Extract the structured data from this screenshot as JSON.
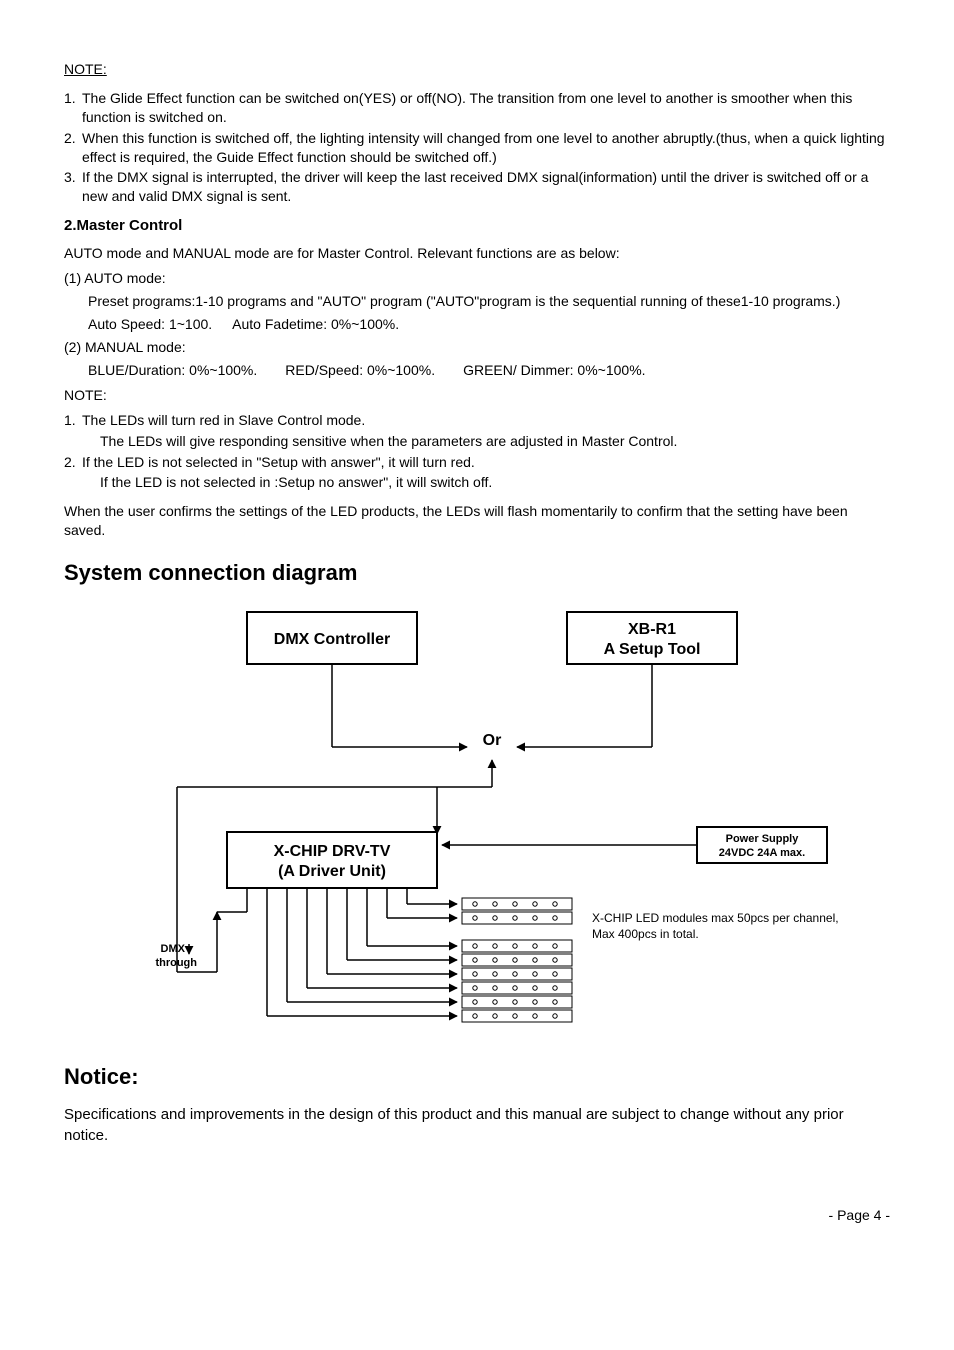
{
  "note_heading": "NOTE:",
  "note_items": [
    {
      "num": "1.",
      "text": "The Glide Effect function can be switched on(YES) or off(NO). The transition from one level to another is smoother when this function is switched on."
    },
    {
      "num": "2.",
      "text": "When this function is switched off, the lighting intensity will changed from one level to another abruptly.(thus, when a quick lighting effect is required, the Guide Effect function should be switched off.)"
    },
    {
      "num": "3.",
      "text": "If the DMX signal is interrupted, the driver will keep the last received DMX signal(information) until the driver is switched off or a new and valid DMX signal is sent."
    }
  ],
  "master": {
    "heading": "2.Master Control",
    "intro": "AUTO mode and MANUAL mode are for Master Control. Relevant functions are as below:",
    "auto_label": "(1) AUTO   mode:",
    "auto_presets": "Preset programs:1-10 programs and \"AUTO\" program (\"AUTO\"program is the sequential running of these1-10 programs.)",
    "auto_speed": "Auto Speed: 1~100.",
    "auto_fade": "Auto Fadetime: 0%~100%.",
    "manual_label": "(2) MANUAL mode:",
    "blue": "BLUE/Duration: 0%~100%.",
    "red": "RED/Speed: 0%~100%.",
    "green": "GREEN/ Dimmer: 0%~100%."
  },
  "note2_heading": "NOTE:",
  "note2_items": [
    {
      "num": "1.",
      "text": "The LEDs will turn red in Slave Control mode."
    },
    {
      "num": "",
      "text": "The LEDs will give responding sensitive when the parameters are adjusted in Master Control."
    },
    {
      "num": "2.",
      "text": "If the LED is not selected in \"Setup with answer\", it will turn red."
    },
    {
      "num": "",
      "text": "If the LED is not selected in :Setup no answer\", it will switch off."
    }
  ],
  "note2_tail": "When the user confirms the settings of the LED products, the LEDs will flash momentarily to confirm that the setting have been saved.",
  "diagram_heading": "System connection diagram",
  "diagram": {
    "dmx_controller": "DMX Controller",
    "xb_r1_line1": "XB-R1",
    "xb_r1_line2": "A Setup Tool",
    "or": "Or",
    "driver_line1": "X-CHIP DRV-TV",
    "driver_line2": "(A Driver Unit)",
    "dmx_through_line1": "DMX",
    "dmx_through_line2": "through",
    "psu_line1": "Power Supply",
    "psu_line2": "24VDC 24A max.",
    "modules_line1": "X-CHIP LED modules max 50pcs per channel,",
    "modules_line2": "Max 400pcs in total."
  },
  "notice_heading": "Notice:",
  "notice_body": "Specifications and improvements in the design of this product and this manual are subject to change without any prior notice.",
  "page_number": "- Page 4 -"
}
